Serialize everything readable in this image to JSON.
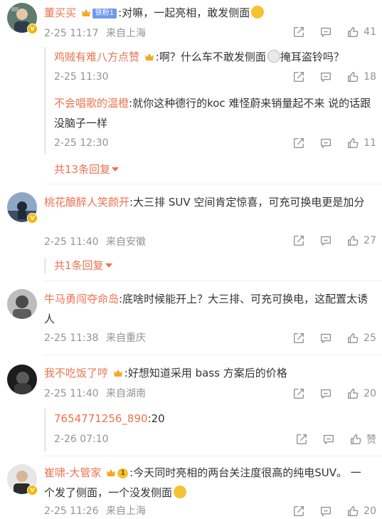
{
  "comments": [
    {
      "username": "董买买",
      "fan_badge": "铁粉1",
      "text": ":对嘛，一起亮相，敢发侧面",
      "time": "2-25 11:17",
      "location": "来自上海",
      "likes": "41",
      "replies": [
        {
          "username": "鸡贼有难八方点赞",
          "text_a": ":啊？什么车不敢发侧面",
          "text_b": "掩耳盗铃吗？",
          "time": "2-25 11:30",
          "likes": "18"
        },
        {
          "username": "不会唱歌的温橙",
          "text": ":就你这种德行的koc 难怪蔚来销量起不来 说的话跟没脑子一样",
          "time": "2-25 12:30",
          "likes": "11"
        }
      ],
      "more_replies": "共13条回复"
    },
    {
      "username": "桃花酿醉人笑颜开",
      "text": ":大三排 SUV 空间肯定惊喜，可充可换电更是加分",
      "time": "2-25 11:40",
      "location": "来自安徽",
      "likes": "27",
      "more_replies": "共1条回复"
    },
    {
      "username": "牛马勇闯夺命岛",
      "text": ":底啥时候能开上？大三排、可充可换电，这配置太诱人",
      "time": "2-25 11:38",
      "location": "来自重庆",
      "likes": "25"
    },
    {
      "username": "我不吃饭了哼",
      "text": ":好想知道采用 bass 方案后的价格",
      "time": "2-25 11:40",
      "location": "来自湖南",
      "likes": "20",
      "replies": [
        {
          "username": "7654771256_890",
          "text": ":20",
          "time": "2-26 07:10",
          "likes": "赞"
        }
      ]
    },
    {
      "username": "崔啸-大管家",
      "level_badge": "1",
      "text": ":今天同时亮相的两台关注度很高的纯电SUV。 一个发了侧面，一个没发侧面",
      "time": "2-25 11:26",
      "location": "来自上海",
      "likes": "20"
    }
  ],
  "colors": {
    "username": "#eb7350",
    "meta": "#939393",
    "text": "#333333",
    "vip": "#f7b500"
  },
  "icons": [
    "share-icon",
    "comment-icon",
    "like-icon",
    "verified-badge-icon",
    "crown-badge-icon"
  ]
}
